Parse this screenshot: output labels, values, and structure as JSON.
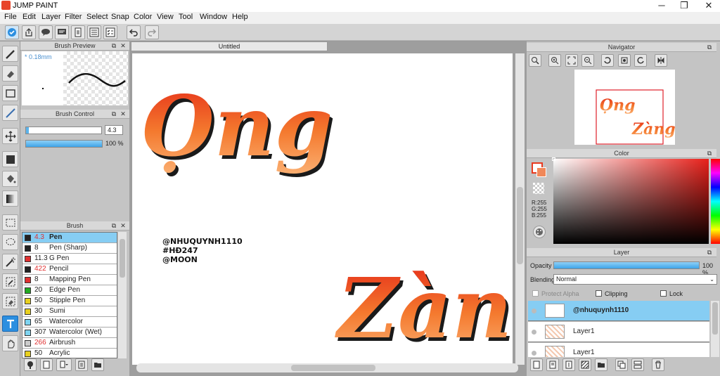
{
  "window": {
    "title": "JUMP PAINT",
    "minimize": "─",
    "maximize": "❐",
    "close": "✕"
  },
  "menu": [
    "File",
    "Edit",
    "Layer",
    "Filter",
    "Select",
    "Snap",
    "Color",
    "View",
    "Tool",
    "Window",
    "Help"
  ],
  "toolbar": {
    "icons": [
      "autosave-icon",
      "export-icon",
      "comment-icon",
      "chat-icon",
      "page-icon",
      "list-icon",
      "checklist-icon",
      "undo-icon",
      "redo-icon"
    ]
  },
  "tools": [
    "pen-tool-icon",
    "eraser-icon",
    "rectangle-icon",
    "brush-line-icon",
    "move-icon",
    "fill-rect-icon",
    "bucket-icon",
    "gradient-icon",
    "rect-select-icon",
    "lasso-icon",
    "magic-wand-icon",
    "select-pen-icon",
    "select-eraser-icon",
    "text-icon",
    "hand-icon"
  ],
  "brush_preview": {
    "title": "Brush Preview",
    "size_label": "0.18mm"
  },
  "brush_control": {
    "title": "Brush Control",
    "size_value": "4.3",
    "opacity_value": "100 %",
    "opacity_fraction": 1.0,
    "size_fraction": 0.04
  },
  "brush": {
    "title": "Brush",
    "items": [
      {
        "size": "4.3",
        "name": "Pen",
        "color": "#222222",
        "size_color": "#e03030",
        "selected": true
      },
      {
        "size": "8",
        "name": "Pen (Sharp)",
        "color": "#222222",
        "size_color": "#222222",
        "selected": false
      },
      {
        "size": "11.3",
        "name": "G Pen",
        "color": "#e03030",
        "size_color": "#222222",
        "selected": false
      },
      {
        "size": "422",
        "name": "Pencil",
        "color": "#222222",
        "size_color": "#e03030",
        "selected": false
      },
      {
        "size": "8",
        "name": "Mapping Pen",
        "color": "#e03030",
        "size_color": "#222222",
        "selected": false
      },
      {
        "size": "20",
        "name": "Edge Pen",
        "color": "#22aa22",
        "size_color": "#222222",
        "selected": false
      },
      {
        "size": "50",
        "name": "Stipple Pen",
        "color": "#e8d020",
        "size_color": "#222222",
        "selected": false
      },
      {
        "size": "30",
        "name": "Sumi",
        "color": "#e8d020",
        "size_color": "#222222",
        "selected": false
      },
      {
        "size": "65",
        "name": "Watercolor",
        "color": "#7fd4f0",
        "size_color": "#222222",
        "selected": false
      },
      {
        "size": "307",
        "name": "Watercolor (Wet)",
        "color": "#7fd4f0",
        "size_color": "#222222",
        "selected": false
      },
      {
        "size": "266",
        "name": "Airbrush",
        "color": "#cccccc",
        "size_color": "#e03030",
        "selected": false
      },
      {
        "size": "50",
        "name": "Acrylic",
        "color": "#e8d020",
        "size_color": "#222222",
        "selected": false
      }
    ]
  },
  "canvas": {
    "tab": "Untitled",
    "line1": "Ọng",
    "line2": "Zàng",
    "credit": [
      "@NHUQUYNH1110",
      "#HĐ247",
      "@MOON"
    ]
  },
  "navigator": {
    "title": "Navigator"
  },
  "color": {
    "title": "Color",
    "r": "R:255",
    "g": "G:255",
    "b": "B:255",
    "main": "#e83a1f"
  },
  "layer": {
    "title": "Layer",
    "opacity_label": "Opacity",
    "opacity_value": "100 %",
    "opacity_fraction": 1.0,
    "blending_label": "Blending",
    "blending_value": "Normal",
    "protect_alpha": "Protect Alpha",
    "clipping": "Clipping",
    "lock": "Lock",
    "items": [
      {
        "name": "@nhuquynh1110",
        "selected": true
      },
      {
        "name": "Layer1",
        "selected": false
      },
      {
        "name": "Layer1",
        "selected": false
      }
    ]
  }
}
